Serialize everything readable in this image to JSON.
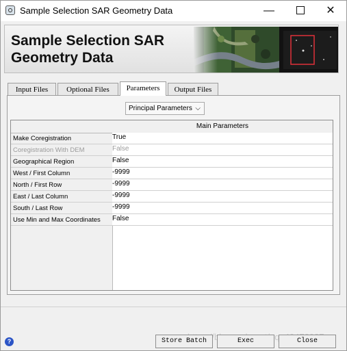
{
  "window": {
    "title": "Sample Selection SAR Geometry Data",
    "minimize_glyph": "—",
    "close_glyph": "✕"
  },
  "banner": {
    "title_line1": "Sample Selection SAR",
    "title_line2": "Geometry Data"
  },
  "tabs": [
    {
      "label": "Input Files",
      "active": false
    },
    {
      "label": "Optional Files",
      "active": false
    },
    {
      "label": "Parameters",
      "active": true
    },
    {
      "label": "Output Files",
      "active": false
    }
  ],
  "parameters": {
    "dropdown_value": "Principal Parameters",
    "dropdown_caret": "⌵",
    "column_header": "Main Parameters",
    "rows": [
      {
        "label": "Make Coregistration",
        "value": "True",
        "enabled": true
      },
      {
        "label": "Coregistration With DEM",
        "value": "False",
        "enabled": false
      },
      {
        "label": "Geographical Region",
        "value": "False",
        "enabled": true
      },
      {
        "label": "West / First Column",
        "value": "-9999",
        "enabled": true
      },
      {
        "label": "North / First Row",
        "value": "-9999",
        "enabled": true
      },
      {
        "label": "East / Last Column",
        "value": "-9999",
        "enabled": true
      },
      {
        "label": "South / Last Row",
        "value": "-9999",
        "enabled": true
      },
      {
        "label": "Use Min and Max Coordinates",
        "value": "False",
        "enabled": true
      }
    ]
  },
  "footer": {
    "help_glyph": "?",
    "store_batch_label": "Store Batch",
    "exec_label": "Exec",
    "close_label": "Close",
    "watermark": "https://blog.csdn.net/qq_40472087"
  },
  "colors": {
    "window_bg": "#f0f0f0",
    "help_icon": "#2c55c6",
    "banner_highlight": "#e0303a"
  },
  "icons": [
    "app-icon",
    "minimize-icon",
    "maximize-icon",
    "close-icon",
    "chevron-down-icon",
    "help-icon"
  ]
}
